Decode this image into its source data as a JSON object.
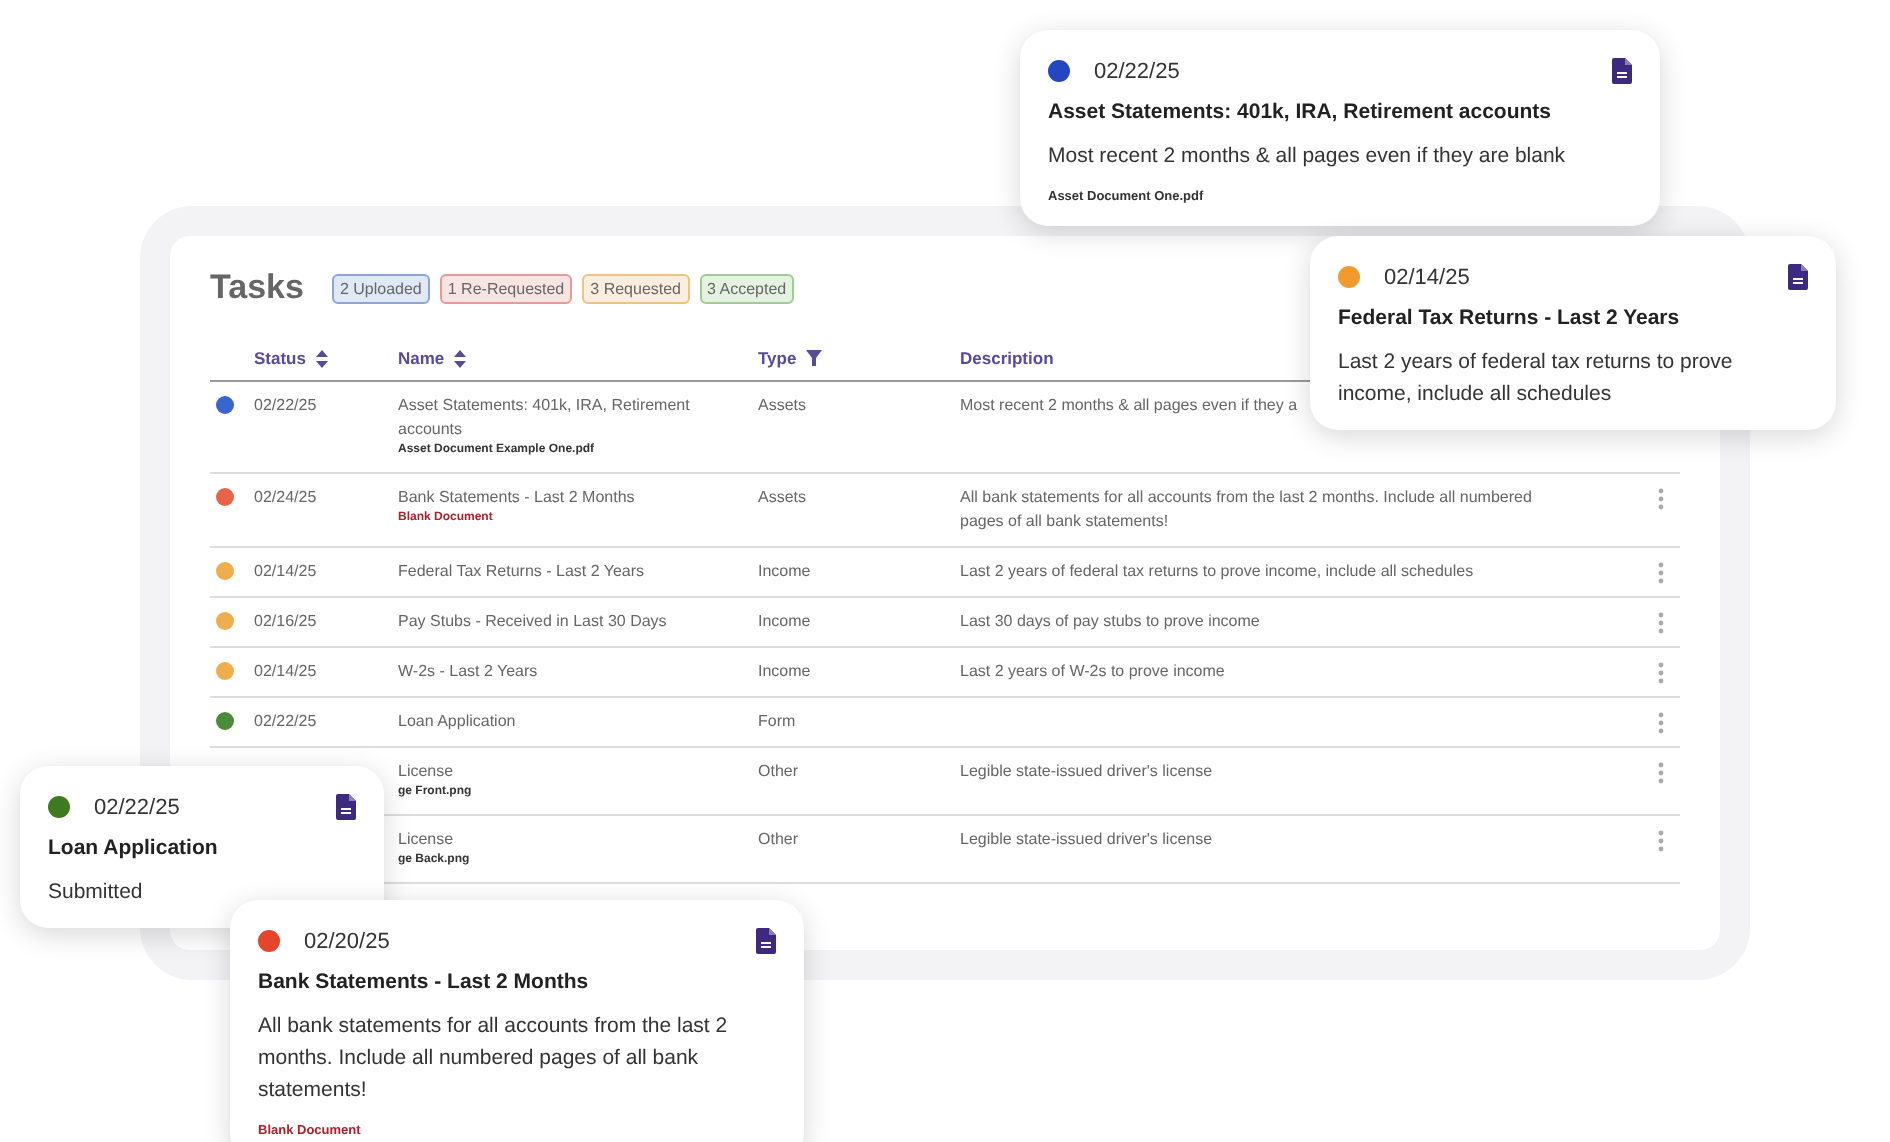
{
  "tasks": {
    "title": "Tasks",
    "badges": [
      {
        "text": "2 Uploaded",
        "color": "#8aa6d8"
      },
      {
        "text": "1 Re-Requested",
        "color": "#e69b94"
      },
      {
        "text": "3 Requested",
        "color": "#efc182"
      },
      {
        "text": "3 Accepted",
        "color": "#9fcc90"
      }
    ],
    "columns": [
      {
        "label": "Status",
        "kind": "sort"
      },
      {
        "label": "Name",
        "kind": "sort"
      },
      {
        "label": "Type",
        "kind": "filter"
      },
      {
        "label": "Description",
        "kind": "plain"
      }
    ],
    "rows": [
      {
        "color": "#3a64d0",
        "date": "02/22/25",
        "name": "Asset Statements: 401k, IRA, Retirement accounts",
        "file": {
          "name": "Asset Document Example One.pdf",
          "kind": "attached"
        },
        "type": "Assets",
        "description": "Most recent 2 months & all pages even if they a",
        "has_menu": false
      },
      {
        "color": "#e8634a",
        "date": "02/24/25",
        "name": "Bank Statements - Last 2 Months",
        "file": {
          "name": "Blank Document",
          "kind": "blank"
        },
        "type": "Assets",
        "description": "All bank statements for all accounts from the last 2 months. Include all numbered pages of all bank statements!",
        "has_menu": true
      },
      {
        "color": "#f0ad4e",
        "date": "02/14/25",
        "name": "Federal Tax Returns - Last 2 Years",
        "type": "Income",
        "description": "Last 2 years of federal tax returns to prove income, include all schedules",
        "has_menu": true
      },
      {
        "color": "#f0ad4e",
        "date": "02/16/25",
        "name": "Pay Stubs - Received in Last 30 Days",
        "type": "Income",
        "description": "Last 30 days of pay stubs to prove income",
        "has_menu": true
      },
      {
        "color": "#f0ad4e",
        "date": "02/14/25",
        "name": "W-2s - Last 2 Years",
        "type": "Income",
        "description": "Last 2 years of W-2s to prove income",
        "has_menu": true
      },
      {
        "color": "#4a8c3a",
        "date": "02/22/25",
        "name": "Loan Application",
        "type": "Form",
        "has_menu": true
      },
      {
        "name": "License",
        "file": {
          "name": "ge Front.png",
          "kind": "attached"
        },
        "type": "Other",
        "description": "Legible state-issued driver's license",
        "has_menu": true
      },
      {
        "name": "License",
        "file": {
          "name": "ge Back.png",
          "kind": "attached"
        },
        "type": "Other",
        "description": "Legible state-issued driver's license",
        "has_menu": true
      }
    ]
  },
  "cards": [
    {
      "color": "#2447c0",
      "date": "02/22/25",
      "title": "Asset Statements: 401k, IRA, Retirement accounts",
      "description": "Most recent 2 months & all pages even if they are blank",
      "file": {
        "name": "Asset Document One.pdf",
        "kind": "attached"
      }
    },
    {
      "color": "#f29a2e",
      "date": "02/14/25",
      "title": "Federal Tax Returns - Last 2 Years",
      "description": "Last 2 years of federal tax returns to prove income, include all schedules"
    },
    {
      "color": "#3f7a22",
      "date": "02/22/25",
      "title": "Loan Application",
      "description": "Submitted"
    },
    {
      "color": "#e5452c",
      "date": "02/20/25",
      "title": "Bank Statements - Last 2 Months",
      "description": "All bank statements for all accounts from the last 2 months. Include all numbered pages of all bank statements!",
      "file": {
        "name": "Blank Document",
        "kind": "blank"
      }
    }
  ]
}
